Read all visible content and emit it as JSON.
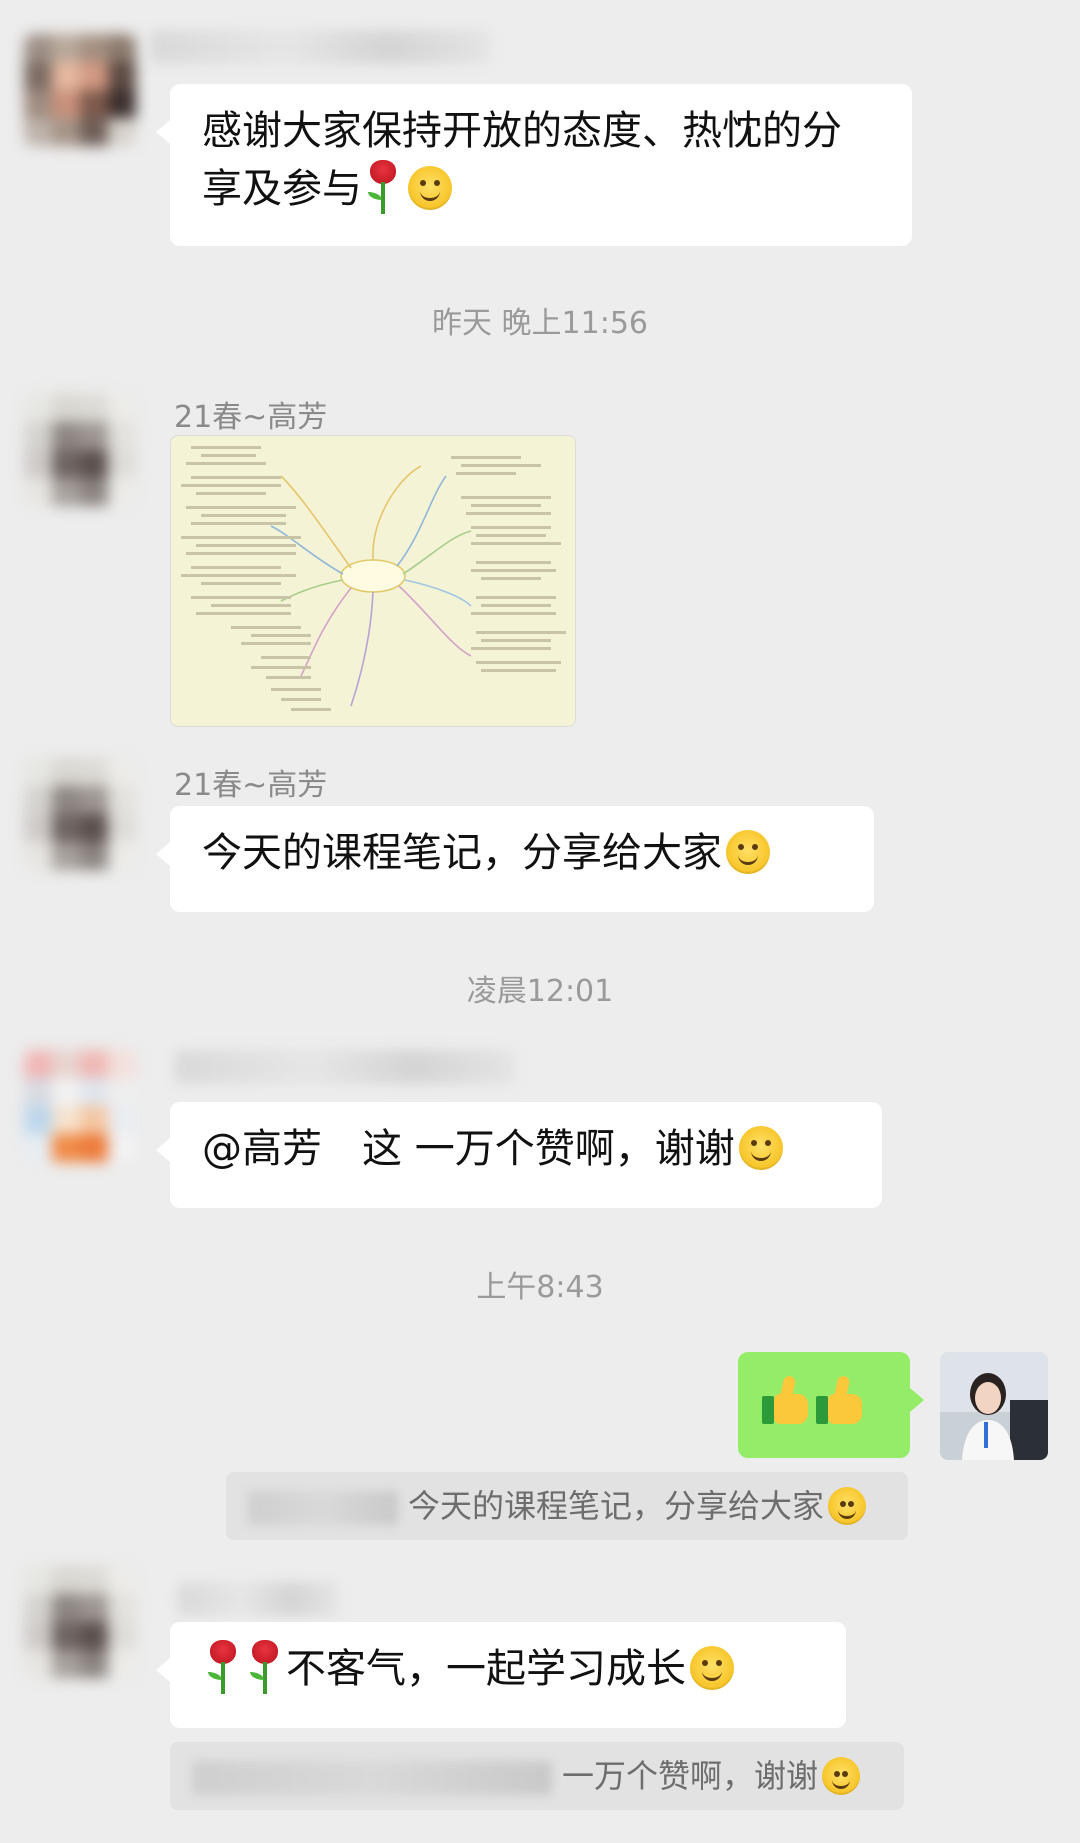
{
  "messages": {
    "m1": {
      "text": "感谢大家保持开放的态度、热忱的分享及参与",
      "emojis": [
        "rose-icon",
        "smile-icon"
      ]
    },
    "ts1": "昨天 晚上11:56",
    "m2": {
      "sender": "21春~高芳",
      "attachment": "mind-map-image"
    },
    "m3": {
      "sender": "21春~高芳",
      "text": "今天的课程笔记，分享给大家"
    },
    "ts2": "凌晨12:01",
    "m4": {
      "mention": "@高芳",
      "text": "这 一万个赞啊，谢谢"
    },
    "ts3": "上午8:43",
    "m5": {
      "emojis": [
        "thumbs-up-icon",
        "thumbs-up-icon"
      ]
    },
    "q5": {
      "text": "今天的课程笔记，分享给大家"
    },
    "m6": {
      "text": "不客气，一起学习成长",
      "emojis": [
        "rose-icon",
        "rose-icon",
        "smile-icon"
      ]
    },
    "q6": {
      "text": "一万个赞啊，谢谢"
    }
  },
  "colors": {
    "background": "#ededed",
    "bubble_other": "#ffffff",
    "bubble_self": "#95ec69",
    "timestamp": "#9a9a9a"
  }
}
